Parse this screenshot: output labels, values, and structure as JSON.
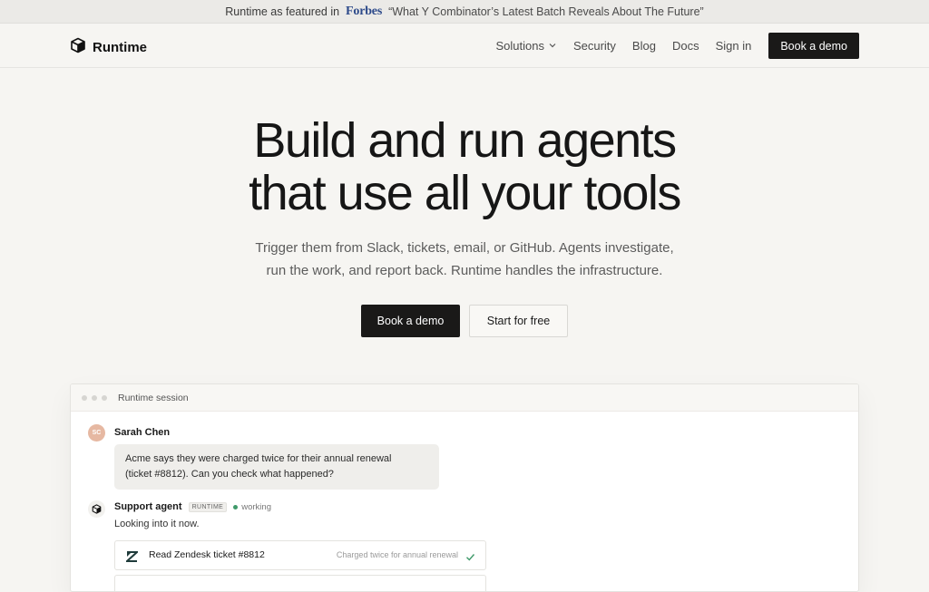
{
  "banner": {
    "prefix": "Runtime as featured in",
    "publication": "Forbes",
    "headline": "“What Y Combinator’s Latest Batch Reveals About The Future”"
  },
  "nav": {
    "brand": "Runtime",
    "links": [
      "Solutions",
      "Security",
      "Blog",
      "Docs",
      "Sign in"
    ],
    "cta": "Book a demo"
  },
  "hero": {
    "title_line1": "Build and run agents",
    "title_line2": "that use all your tools",
    "sub_line1": "Trigger them from Slack, tickets, email, or GitHub. Agents investigate,",
    "sub_line2": "run the work, and report back. Runtime handles the infrastructure.",
    "primary_cta": "Book a demo",
    "secondary_cta": "Start for free"
  },
  "session": {
    "title": "Runtime session",
    "user": {
      "initials": "SC",
      "name": "Sarah Chen",
      "message_line1": "Acme says they were charged twice for their annual renewal",
      "message_line2": "(ticket #8812). Can you check what happened?"
    },
    "agent": {
      "name": "Support agent",
      "tag": "RUNTIME",
      "status": "working",
      "message": "Looking into it now."
    },
    "steps": [
      {
        "title": "Read Zendesk ticket #8812",
        "note": "Charged twice for annual renewal",
        "done": true
      }
    ]
  },
  "colors": {
    "background": "#f6f5f2",
    "dark_button": "#1a1918",
    "forbes_blue": "#2d4a8a",
    "status_green": "#3f9a6a",
    "avatar": "#e6b8a2"
  },
  "icons": {
    "logo": "cube-icon",
    "chevron": "chevron-down-icon",
    "zendesk": "zendesk-icon",
    "check": "check-icon"
  }
}
